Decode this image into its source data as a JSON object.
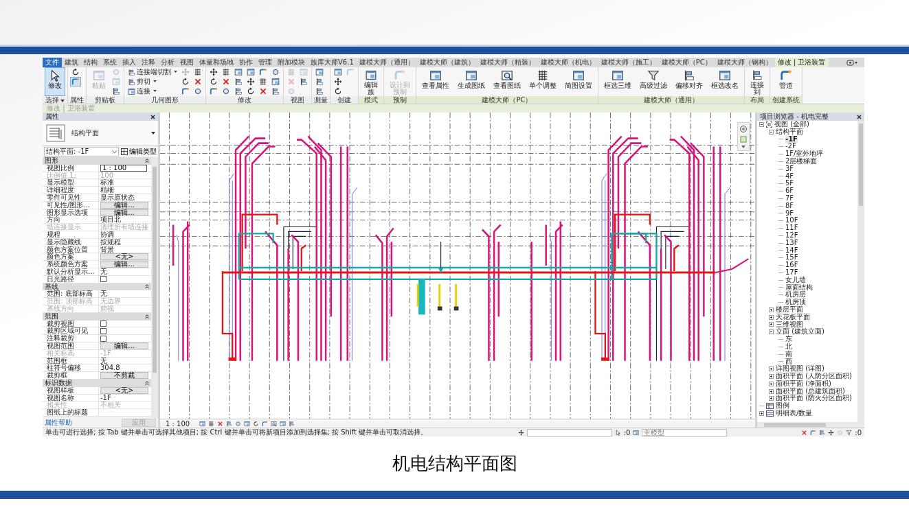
{
  "ribbon": {
    "tabs": [
      {
        "label": "文件",
        "kind": "file",
        "selected": false
      },
      {
        "label": "建筑",
        "kind": "tab",
        "selected": false
      },
      {
        "label": "结构",
        "kind": "tab",
        "selected": false
      },
      {
        "label": "系统",
        "kind": "tab",
        "selected": false
      },
      {
        "label": "插入",
        "kind": "tab",
        "selected": false
      },
      {
        "label": "注释",
        "kind": "tab",
        "selected": false
      },
      {
        "label": "分析",
        "kind": "tab",
        "selected": false
      },
      {
        "label": "视图",
        "kind": "tab",
        "selected": false
      },
      {
        "label": "体量和场地",
        "kind": "tab",
        "selected": false
      },
      {
        "label": "协作",
        "kind": "tab",
        "selected": false
      },
      {
        "label": "管理",
        "kind": "tab",
        "selected": false
      },
      {
        "label": "附加模块",
        "kind": "tab",
        "selected": false
      },
      {
        "label": "族库大师V6.1",
        "kind": "tab",
        "selected": false
      },
      {
        "label": "建模大师（通用）",
        "kind": "tab",
        "selected": false
      },
      {
        "label": "建模大师（建筑）",
        "kind": "tab",
        "selected": false
      },
      {
        "label": "建模大师（精装）",
        "kind": "tab",
        "selected": false
      },
      {
        "label": "建模大师（机电）",
        "kind": "tab",
        "selected": false
      },
      {
        "label": "建模大师（施工）",
        "kind": "tab",
        "selected": false
      },
      {
        "label": "建模大师（PC）",
        "kind": "tab",
        "selected": false
      },
      {
        "label": "建模大师（钢构）",
        "kind": "tab",
        "selected": false
      },
      {
        "label": "修改 | 卫浴装置",
        "kind": "tab",
        "selected": true
      }
    ],
    "groups": [
      {
        "label": "选择",
        "menu": true,
        "contextual": false,
        "tools": [
          {
            "kind": "large",
            "label": "修改",
            "selected": true,
            "disabled": false
          }
        ]
      },
      {
        "label": "属性",
        "contextual": false,
        "tools": [
          {
            "kind": "icon",
            "selected": false,
            "disabled": false
          },
          {
            "kind": "icon",
            "selected": true,
            "disabled": false
          }
        ]
      },
      {
        "label": "剪贴板",
        "contextual": false,
        "tools": [
          {
            "kind": "large",
            "label": "粘贴",
            "disabled": true
          },
          {
            "kind": "icon",
            "disabled": true
          },
          {
            "kind": "icon",
            "disabled": true
          },
          {
            "kind": "icon",
            "disabled": false
          }
        ]
      },
      {
        "label": "几何图形",
        "contextual": false,
        "tools": [
          {
            "kind": "small",
            "label": "连接端切割",
            "menu": true,
            "disabled": false
          },
          {
            "kind": "small",
            "label": "剪切",
            "menu": true,
            "disabled": false
          },
          {
            "kind": "small",
            "label": "连接",
            "menu": true,
            "disabled": false
          },
          {
            "kind": "icon",
            "disabled": true
          },
          {
            "kind": "icon",
            "disabled": false
          },
          {
            "kind": "icon",
            "disabled": false
          },
          {
            "kind": "icon",
            "disabled": false
          },
          {
            "kind": "icon",
            "disabled": false
          },
          {
            "kind": "icon",
            "disabled": false
          }
        ]
      },
      {
        "label": "修改",
        "contextual": false,
        "tools": [
          {
            "kind": "icon",
            "disabled": false
          },
          {
            "kind": "icon",
            "disabled": false
          },
          {
            "kind": "icon",
            "disabled": false
          },
          {
            "kind": "icon",
            "disabled": false
          },
          {
            "kind": "icon",
            "disabled": false
          },
          {
            "kind": "icon",
            "disabled": false
          },
          {
            "kind": "icon",
            "disabled": false
          },
          {
            "kind": "icon",
            "disabled": false
          },
          {
            "kind": "icon",
            "disabled": false
          },
          {
            "kind": "icon",
            "disabled": false
          },
          {
            "kind": "icon",
            "disabled": false
          },
          {
            "kind": "icon",
            "disabled": false
          },
          {
            "kind": "icon",
            "disabled": false
          },
          {
            "kind": "icon",
            "disabled": false
          },
          {
            "kind": "icon",
            "disabled": false
          },
          {
            "kind": "icon",
            "disabled": false
          },
          {
            "kind": "icon",
            "disabled": false
          },
          {
            "kind": "icon",
            "disabled": false
          }
        ]
      },
      {
        "label": "视图",
        "contextual": false,
        "tools": [
          {
            "kind": "icon",
            "disabled": true
          },
          {
            "kind": "icon",
            "disabled": true
          },
          {
            "kind": "icon",
            "disabled": true
          },
          {
            "kind": "icon",
            "disabled": true
          },
          {
            "kind": "icon",
            "disabled": false
          }
        ]
      },
      {
        "label": "测量",
        "contextual": false,
        "tools": [
          {
            "kind": "icon",
            "disabled": false
          },
          {
            "kind": "icon",
            "disabled": false
          },
          {
            "kind": "icon",
            "disabled": false
          }
        ]
      },
      {
        "label": "创建",
        "contextual": false,
        "tools": [
          {
            "kind": "icon",
            "disabled": false
          },
          {
            "kind": "icon",
            "disabled": false
          },
          {
            "kind": "icon",
            "disabled": false
          },
          {
            "kind": "icon",
            "disabled": true
          }
        ]
      },
      {
        "label": "模式",
        "contextual": true,
        "tools": [
          {
            "kind": "large",
            "label": "编辑族",
            "wrap": true,
            "disabled": false
          }
        ]
      },
      {
        "label": "预制",
        "contextual": true,
        "tools": [
          {
            "kind": "large",
            "label": "设计到预制",
            "wrap": true,
            "disabled": true
          }
        ]
      },
      {
        "label": "建模大师（PC）",
        "contextual": true,
        "tools": [
          {
            "kind": "large",
            "label": "查看属性",
            "disabled": false
          },
          {
            "kind": "large",
            "label": "生成图纸",
            "disabled": false
          },
          {
            "kind": "large",
            "label": "查看图纸",
            "disabled": false
          },
          {
            "kind": "large",
            "label": "单个调整",
            "disabled": false
          },
          {
            "kind": "large",
            "label": "简图设置",
            "disabled": false
          }
        ]
      },
      {
        "label": "建模大师（通用）",
        "contextual": true,
        "tools": [
          {
            "kind": "large",
            "label": "框选三维",
            "disabled": false
          },
          {
            "kind": "large",
            "label": "高级过滤",
            "disabled": false
          },
          {
            "kind": "large",
            "label": "偏移对齐",
            "disabled": false
          },
          {
            "kind": "large",
            "label": "框选改名",
            "disabled": false
          }
        ]
      },
      {
        "label": "布局",
        "contextual": true,
        "tools": [
          {
            "kind": "large",
            "label": "连接到",
            "wrap": true,
            "disabled": false
          }
        ]
      },
      {
        "label": "创建系统",
        "contextual": true,
        "tools": [
          {
            "kind": "large",
            "label": "管道",
            "disabled": false
          }
        ]
      }
    ]
  },
  "context_bar": {
    "text": "修改 | 卫浴装置"
  },
  "properties": {
    "title": "属性",
    "type_name": "结构平面",
    "instance_selector": "结构平面: -1F",
    "edit_type": "编辑类型",
    "sections": [
      {
        "title": "图形",
        "expanded": true,
        "rows": [
          {
            "label": "视图比例",
            "value": "1 : 100",
            "kind": "input",
            "disabled": false
          },
          {
            "label": "比例值 1:",
            "value": "100",
            "kind": "text",
            "disabled": true
          },
          {
            "label": "显示模型",
            "value": "标准",
            "kind": "text",
            "disabled": false
          },
          {
            "label": "详细程度",
            "value": "精细",
            "kind": "text",
            "disabled": false
          },
          {
            "label": "零件可见性",
            "value": "显示原状态",
            "kind": "text",
            "disabled": false
          },
          {
            "label": "可见性/图形...",
            "value": "编辑...",
            "kind": "button",
            "disabled": false
          },
          {
            "label": "图形显示选项",
            "value": "编辑...",
            "kind": "button",
            "disabled": false
          },
          {
            "label": "方向",
            "value": "项目北",
            "kind": "text",
            "disabled": false
          },
          {
            "label": "墙连接显示",
            "value": "清理所有墙连接",
            "kind": "text",
            "disabled": true
          },
          {
            "label": "规程",
            "value": "协调",
            "kind": "text",
            "disabled": false
          },
          {
            "label": "显示隐藏线",
            "value": "按规程",
            "kind": "text",
            "disabled": false
          },
          {
            "label": "颜色方案位置",
            "value": "背景",
            "kind": "text",
            "disabled": false
          },
          {
            "label": "颜色方案",
            "value": "<无>",
            "kind": "button",
            "disabled": false
          },
          {
            "label": "系统颜色方案",
            "value": "编辑...",
            "kind": "button",
            "disabled": false
          },
          {
            "label": "默认分析显示...",
            "value": "无",
            "kind": "text",
            "disabled": false
          },
          {
            "label": "日光路径",
            "kind": "checkbox",
            "checked": false,
            "disabled": false
          }
        ]
      },
      {
        "title": "基线",
        "expanded": true,
        "rows": [
          {
            "label": "范围: 底部标高",
            "value": "无",
            "kind": "text",
            "disabled": false
          },
          {
            "label": "范围: 顶部标高",
            "value": "无边界",
            "kind": "text",
            "disabled": true
          },
          {
            "label": "基线方向",
            "value": "俯视",
            "kind": "text",
            "disabled": true
          }
        ]
      },
      {
        "title": "范围",
        "expanded": true,
        "rows": [
          {
            "label": "裁剪视图",
            "kind": "checkbox",
            "checked": false,
            "disabled": false
          },
          {
            "label": "裁剪区域可见",
            "kind": "checkbox",
            "checked": false,
            "disabled": false
          },
          {
            "label": "注释裁剪",
            "kind": "checkbox",
            "checked": false,
            "disabled": false
          },
          {
            "label": "视图范围",
            "value": "编辑...",
            "kind": "button",
            "disabled": false
          },
          {
            "label": "相关标高",
            "value": "-1F",
            "kind": "text",
            "disabled": true
          },
          {
            "label": "范围框",
            "value": "无",
            "kind": "text",
            "disabled": false
          },
          {
            "label": "柱符号偏移",
            "value": "304.8",
            "kind": "text",
            "disabled": false
          },
          {
            "label": "裁剪框",
            "value": "不剪裁",
            "kind": "button",
            "disabled": false
          }
        ]
      },
      {
        "title": "标识数据",
        "expanded": true,
        "rows": [
          {
            "label": "视图样板",
            "value": "<无>",
            "kind": "button",
            "disabled": false
          },
          {
            "label": "视图名称",
            "value": "-1F",
            "kind": "text",
            "disabled": false
          },
          {
            "label": "相关性",
            "value": "不相关",
            "kind": "text",
            "disabled": true
          },
          {
            "label": "图纸上的标题",
            "kind": "text",
            "disabled": false
          }
        ]
      }
    ],
    "help_link": "属性帮助",
    "apply_button": "应用"
  },
  "view_bar": {
    "scale": "1 : 100"
  },
  "browser": {
    "title": "项目浏览器 - 机电完整",
    "tree": [
      {
        "label": "视图 (全部)",
        "kind": "views",
        "expanded": true,
        "selected": false,
        "children": [
          {
            "label": "结构平面",
            "expanded": true,
            "selected": false,
            "children": [
              {
                "label": "-1F",
                "selected": true
              },
              {
                "label": "-2F",
                "selected": false
              },
              {
                "label": "1F/室外地坪",
                "selected": false
              },
              {
                "label": "2层楼梯面",
                "selected": false
              },
              {
                "label": "3F",
                "selected": false
              },
              {
                "label": "4F",
                "selected": false
              },
              {
                "label": "5F",
                "selected": false
              },
              {
                "label": "6F",
                "selected": false
              },
              {
                "label": "7F",
                "selected": false
              },
              {
                "label": "8F",
                "selected": false
              },
              {
                "label": "9F",
                "selected": false
              },
              {
                "label": "10F",
                "selected": false
              },
              {
                "label": "11F",
                "selected": false
              },
              {
                "label": "12F",
                "selected": false
              },
              {
                "label": "13F",
                "selected": false
              },
              {
                "label": "14F",
                "selected": false
              },
              {
                "label": "15F",
                "selected": false
              },
              {
                "label": "16F",
                "selected": false
              },
              {
                "label": "17F",
                "selected": false
              },
              {
                "label": "女儿墙",
                "selected": false
              },
              {
                "label": "屋面结构",
                "selected": false
              },
              {
                "label": "机房层",
                "selected": false
              },
              {
                "label": "机房顶",
                "selected": false
              }
            ]
          },
          {
            "label": "楼层平面",
            "expanded": false,
            "selected": false
          },
          {
            "label": "天花板平面",
            "expanded": false,
            "selected": false
          },
          {
            "label": "三维视图",
            "expanded": false,
            "selected": false
          },
          {
            "label": "立面 (建筑立面)",
            "expanded": true,
            "selected": false,
            "children": [
              {
                "label": "东",
                "selected": false
              },
              {
                "label": "北",
                "selected": false
              },
              {
                "label": "南",
                "selected": false
              },
              {
                "label": "西",
                "selected": false
              }
            ]
          },
          {
            "label": "详图视图 (详图)",
            "expanded": false,
            "selected": false
          },
          {
            "label": "面积平面 (人防分区面积)",
            "expanded": false,
            "selected": false
          },
          {
            "label": "面积平面 (净面积)",
            "expanded": false,
            "selected": false
          },
          {
            "label": "面积平面 (总建筑面积)",
            "expanded": false,
            "selected": false
          },
          {
            "label": "面积平面 (防火分区面积)",
            "expanded": false,
            "selected": false
          }
        ]
      },
      {
        "label": "图例",
        "kind": "legend",
        "selected": false
      },
      {
        "label": "明细表/数量",
        "kind": "schedule",
        "expanded": false,
        "selected": false
      }
    ]
  },
  "status_bar": {
    "message": "单击可进行选择; 按 Tab 键并单击可选择其他项目; 按 Ctrl 键并单击可将新项目添加到选择集; 按 Shift 键并单击可取消选择。",
    "selection_count": ":0",
    "workset": "主模型",
    "filter_count": ":0"
  },
  "slide": {
    "caption": "机电结构平面图"
  }
}
